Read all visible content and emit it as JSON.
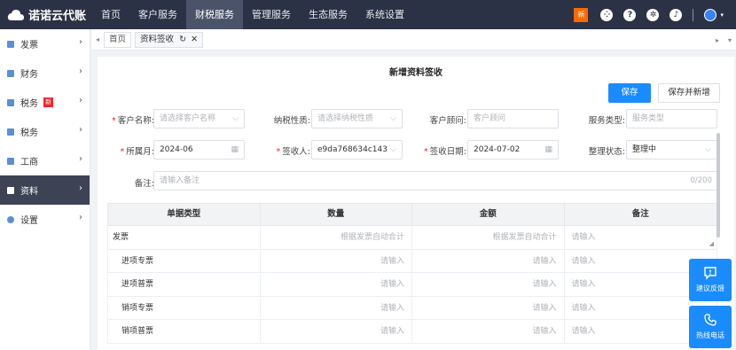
{
  "header": {
    "logo_text": "诺诺云代账",
    "nav": [
      {
        "label": "首页",
        "active": false
      },
      {
        "label": "客户服务",
        "active": false
      },
      {
        "label": "财税服务",
        "active": true
      },
      {
        "label": "管理服务",
        "active": false
      },
      {
        "label": "生态服务",
        "active": false
      },
      {
        "label": "系统设置",
        "active": false
      }
    ],
    "new_badge": "新",
    "icons": [
      "grid-icon",
      "help-icon",
      "settings-icon",
      "bell-icon",
      "user-avatar"
    ]
  },
  "sidebar": {
    "items": [
      {
        "label": "发票",
        "icon": "invoice-icon",
        "badge": ""
      },
      {
        "label": "财务",
        "icon": "finance-icon",
        "badge": ""
      },
      {
        "label": "税务",
        "icon": "tax-icon",
        "badge": "新"
      },
      {
        "label": "税务",
        "icon": "tax2-icon",
        "badge": ""
      },
      {
        "label": "工商",
        "icon": "business-icon",
        "badge": ""
      },
      {
        "label": "资料",
        "icon": "docs-icon",
        "badge": "",
        "active": true
      },
      {
        "label": "设置",
        "icon": "settings-icon",
        "badge": ""
      }
    ]
  },
  "tabs": [
    {
      "label": "首页",
      "closable": false,
      "active": false
    },
    {
      "label": "资料签收",
      "closable": true,
      "active": true
    }
  ],
  "page": {
    "title": "新增资料签收",
    "save_label": "保存",
    "save_add_label": "保存并新增"
  },
  "form": {
    "customer_name": {
      "label": "客户名称:",
      "placeholder": "请选择客户名称"
    },
    "tax_nature": {
      "label": "纳税性质:",
      "placeholder": "请选择纳税性质"
    },
    "advisor": {
      "label": "客户顾问:",
      "placeholder": "客户顾问"
    },
    "service_type": {
      "label": "服务类型:",
      "placeholder": "服务类型"
    },
    "period": {
      "label": "所属月:",
      "value": "2024-06"
    },
    "receiver": {
      "label": "签收人:",
      "value": "e9da768634c143..."
    },
    "receive_date": {
      "label": "签收日期:",
      "value": "2024-07-02"
    },
    "status": {
      "label": "整理状态:",
      "value": "整理中"
    },
    "remark": {
      "label": "备注:",
      "placeholder": "请输入备注",
      "count": "0/200"
    }
  },
  "table": {
    "headers": [
      "单据类型",
      "数量",
      "金额",
      "备注"
    ],
    "rows": [
      {
        "name": "发票",
        "qty": "根据发票自动合计",
        "amount": "根据发票自动合计",
        "note": "请输入",
        "indent": false
      },
      {
        "name": "进项专票",
        "qty": "请输入",
        "amount": "请输入",
        "note": "请输入",
        "indent": true
      },
      {
        "name": "进项普票",
        "qty": "请输入",
        "amount": "请输入",
        "note": "请输入",
        "indent": true
      },
      {
        "name": "销项专票",
        "qty": "请输入",
        "amount": "请输入",
        "note": "请输入",
        "indent": true
      },
      {
        "name": "销项普票",
        "qty": "请输入",
        "amount": "请输入",
        "note": "请输入",
        "indent": true
      }
    ]
  },
  "floating": {
    "feedback_label": "建议反馈",
    "hotline_label": "热线电话"
  },
  "colors": {
    "topbar": "#2b3245",
    "primary": "#1a8cff",
    "sidebar_active": "#3d4354",
    "required": "#f5222d"
  }
}
